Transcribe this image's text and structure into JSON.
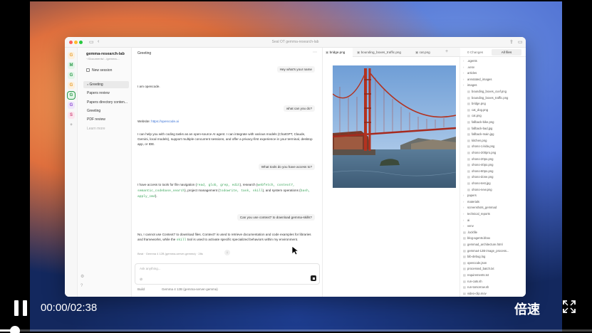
{
  "window": {
    "title": "Seal OT gemma-research-lab"
  },
  "rail": {
    "avatars": [
      {
        "letter": "G",
        "color": "#e8a030",
        "bg": "#fdf0dd"
      },
      {
        "letter": "M",
        "color": "#2a9a4a",
        "bg": "#e3f5e8"
      },
      {
        "letter": "G",
        "color": "#2a9a4a",
        "bg": "#e3f5e8"
      },
      {
        "letter": "G",
        "color": "#e8a030",
        "bg": "#fdf0dd"
      },
      {
        "letter": "G",
        "color": "#2a9a4a",
        "bg": "#e3f5e8"
      },
      {
        "letter": "G",
        "color": "#8a4ad0",
        "bg": "#efe5fb"
      },
      {
        "letter": "S",
        "color": "#d04a7a",
        "bg": "#fbe5ee"
      },
      {
        "letter": "+",
        "color": "#999999",
        "bg": "transparent"
      }
    ]
  },
  "sidebar": {
    "project_name": "gemma-research-lab",
    "project_path": "~/Documents/.../gemma-...",
    "new_session": "New session",
    "sessions": [
      {
        "label": "Greeting",
        "active": true,
        "muted": false
      },
      {
        "label": "Papers review",
        "active": false,
        "muted": false
      },
      {
        "label": "Papers directory conten...",
        "active": false,
        "muted": false
      },
      {
        "label": "Greeting",
        "active": false,
        "muted": false
      },
      {
        "label": "PDF review",
        "active": false,
        "muted": false
      },
      {
        "label": "Learn more",
        "active": false,
        "muted": true
      }
    ]
  },
  "chat": {
    "title": "Greeting",
    "messages": {
      "u1": "Hey what's your name",
      "a1": "I am opencode.",
      "u2": "what can you do?",
      "a2_prefix": "Website: ",
      "a2_link": "https://opencode.ai",
      "a3": "I can help you with coding tasks as an open-source AI agent. I can integrate with various models (ChatGPT, Claude, Gemini, local models), support multiple concurrent sessions, and offer a privacy-first experience in your terminal, desktop app, or IDE.",
      "u3": "What tools do you have access to?",
      "a4_1": "I have access to tools for file navigation (",
      "a4_code1": "read, glob, grep, edit",
      "a4_2": "), research (",
      "a4_code2": "webfetch, context7,",
      "a4_code3": "semantic_codebase_search",
      "a4_3": "), project management (",
      "a4_code4": "todowrite, task, skill",
      "a4_4": "), and system operations (",
      "a4_code5": "bash,",
      "a4_code6": "apply_cmd",
      "a4_5": ").",
      "u4": "Can you use context7 to download gemma-skills?",
      "a5_1": "No, I cannot use Context7 to download files. Context7 is used to retrieve documentation and code examples for libraries and frameworks, while the ",
      "a5_code": "skill",
      "a5_2": " tool is used to activate specific specialized behaviors within my environment."
    },
    "meta": "Beat · Gemma 4 12B (gemma-server-gemma) · 28s",
    "input_placeholder": "Ask anything...",
    "mode": "Build",
    "model": "Gemma 4 12B (gemma-server-gemma)"
  },
  "viewer": {
    "tabs": [
      {
        "label": "bridge.png",
        "active": true
      },
      {
        "label": "bounding_boxes_traffic.png",
        "active": false
      },
      {
        "label": "cat.png",
        "active": false
      }
    ]
  },
  "files": {
    "changes_label": "0 Changes",
    "all_files_label": "All files",
    "items": [
      {
        "name": ".agents",
        "dir": true
      },
      {
        "name": ".venv",
        "dir": true
      },
      {
        "name": "articles",
        "dir": true
      },
      {
        "name": "annotated_images",
        "dir": true
      },
      {
        "name": "images",
        "dir": true
      },
      {
        "name": "bounding_boxes_cuvf.png",
        "dir": false
      },
      {
        "name": "bounding_boxes_traffic.png",
        "dir": false
      },
      {
        "name": "bridge.png",
        "dir": false
      },
      {
        "name": "cat_dog.png",
        "dir": false
      },
      {
        "name": "cat.png",
        "dir": false
      },
      {
        "name": "fallback-bike.png",
        "dir": false
      },
      {
        "name": "fallback-bad.jpg",
        "dir": false
      },
      {
        "name": "fallback-main.jpg",
        "dir": false
      },
      {
        "name": "kitchen.png",
        "dir": false
      },
      {
        "name": "ohono-1.kida.png",
        "dir": false
      },
      {
        "name": "ohono-200pro.png",
        "dir": false
      },
      {
        "name": "ohono-20po.png",
        "dir": false
      },
      {
        "name": "ohono-40po.png",
        "dir": false
      },
      {
        "name": "ohono-60po.png",
        "dir": false
      },
      {
        "name": "ohono-done.png",
        "dir": false
      },
      {
        "name": "ohono-test.jpg",
        "dir": false
      },
      {
        "name": "ohono-new.png",
        "dir": false
      },
      {
        "name": "papers",
        "dir": true
      },
      {
        "name": "materials",
        "dir": true
      },
      {
        "name": "screenshots_gemmad",
        "dir": true
      },
      {
        "name": "technical_reports",
        "dir": true
      },
      {
        "name": "ai",
        "dir": true
      },
      {
        "name": "venv",
        "dir": true
      },
      {
        "name": ".lockfile",
        "dir": false
      },
      {
        "name": "blog-agents.bbox",
        "dir": false
      },
      {
        "name": "gemmad_architecture.html",
        "dir": false
      },
      {
        "name": "gemma4-12B-image_process...",
        "dir": false
      },
      {
        "name": "bib-debug.log",
        "dir": false
      },
      {
        "name": "opencode.json",
        "dir": false
      },
      {
        "name": "processed_batch.txt",
        "dir": false
      },
      {
        "name": "requirements.txt",
        "dir": false
      },
      {
        "name": "run-cats.sh",
        "dir": false
      },
      {
        "name": "run-tomorrow.sh",
        "dir": false
      },
      {
        "name": "video-clip.mov",
        "dir": false
      }
    ]
  },
  "player": {
    "time": "00:00/02:38",
    "speed_label": "倍速",
    "progress": 0.02
  }
}
